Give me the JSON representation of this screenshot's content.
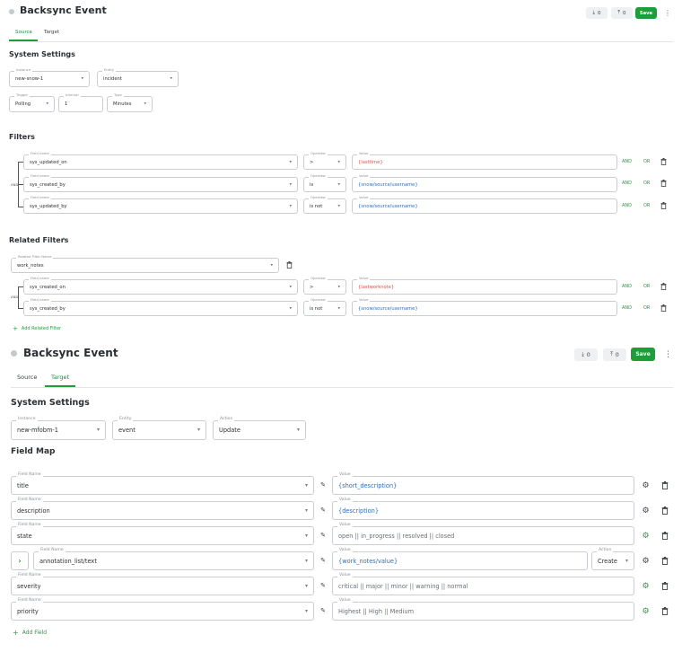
{
  "top": {
    "title": "Backsync Event",
    "download_count": "0",
    "upload_count": "0",
    "save_label": "Save",
    "tabs": [
      "Source",
      "Target"
    ],
    "active_tab": "Source"
  },
  "source": {
    "system_settings_heading": "System Settings",
    "instance": {
      "label": "Instance",
      "value": "new-snow-1"
    },
    "entity": {
      "label": "Entity",
      "value": "incident"
    },
    "trigger": {
      "label": "Trigger",
      "value": "Polling"
    },
    "interval": {
      "label": "Interval",
      "value": "1"
    },
    "type": {
      "label": "Type",
      "value": "Minutes"
    },
    "filters_heading": "Filters",
    "group_label": "AND",
    "filters": [
      {
        "field_label": "Field name",
        "field": "sys_updated_on",
        "op_label": "Operator",
        "op": ">",
        "value_label": "Value",
        "value": "{lasttime}",
        "value_color": "red"
      },
      {
        "field_label": "Field name",
        "field": "sys_created_by",
        "op_label": "Operator",
        "op": "is",
        "value_label": "Value",
        "value": "{snow/source/username}",
        "value_color": "blue"
      },
      {
        "field_label": "Field name",
        "field": "sys_updated_by",
        "op_label": "Operator",
        "op": "is not",
        "value_label": "Value",
        "value": "{snow/source/username}",
        "value_color": "blue"
      }
    ],
    "and_label": "AND",
    "or_label": "OR",
    "related_filters_heading": "Related Filters",
    "related_filter_name": {
      "label": "Related Filter Name",
      "value": "work_notes"
    },
    "related_filters": [
      {
        "field_label": "Field name",
        "field": "sys_created_on",
        "op_label": "Operator",
        "op": ">",
        "value_label": "Value",
        "value": "{lastworknote}",
        "value_color": "red"
      },
      {
        "field_label": "Field name",
        "field": "sys_created_by",
        "op_label": "Operator",
        "op": "is not",
        "value_label": "Value",
        "value": "{snow/source/username}",
        "value_color": "blue"
      }
    ],
    "add_related_filter_label": "Add Related Filter"
  },
  "target_panel": {
    "title": "Backsync Event",
    "download_count": "0",
    "upload_count": "0",
    "save_label": "Save",
    "tabs": [
      "Source",
      "Target"
    ],
    "active_tab": "Target",
    "system_settings_heading": "System Settings",
    "instance": {
      "label": "Instance",
      "value": "new-mfobm-1"
    },
    "entity": {
      "label": "Entity",
      "value": "event"
    },
    "action": {
      "label": "Action",
      "value": "Update"
    },
    "field_map_heading": "Field Map",
    "rows": [
      {
        "field_label": "Field Name",
        "field": "title",
        "value_label": "Value",
        "value": "{short_description}",
        "value_color": "blue",
        "gear_color": "dark"
      },
      {
        "field_label": "Field Name",
        "field": "description",
        "value_label": "Value",
        "value": "{description}",
        "value_color": "blue",
        "gear_color": "dark"
      },
      {
        "field_label": "Field Name",
        "field": "state",
        "value_label": "Value",
        "value": "open || in_progress || resolved || closed",
        "value_color": "gray",
        "gear_color": "green"
      },
      {
        "field_label": "Field Name",
        "field": "annotation_list/text",
        "value_label": "Value",
        "value": "{work_notes/value}",
        "value_color": "blue",
        "gear_color": "dark",
        "action_label": "Action",
        "action": "Create"
      },
      {
        "field_label": "Field Name",
        "field": "severity",
        "value_label": "Value",
        "value": "critical || major || minor || warning || normal",
        "value_color": "gray",
        "gear_color": "green"
      },
      {
        "field_label": "Field Name",
        "field": "priority",
        "value_label": "Value",
        "value": "Highest || High || Medium",
        "value_color": "gray",
        "gear_color": "green"
      }
    ],
    "add_field_label": "Add Field"
  },
  "icons": {
    "download": "download-icon",
    "upload": "upload-icon",
    "kebab": "kebab-icon",
    "trash": "trash-icon",
    "gear": "gear-icon",
    "pencil": "pencil-icon",
    "chevron_up": "chevron-up-icon",
    "chevron_right": "chevron-right-icon",
    "plus": "plus-icon"
  },
  "colors": {
    "accent": "#1e9e3a",
    "red_value": "#d9534f",
    "blue_value": "#2f6fb6"
  }
}
